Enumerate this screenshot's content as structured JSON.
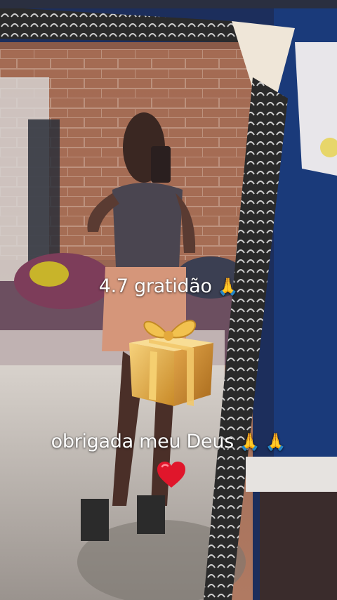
{
  "overlay": {
    "line1_text": "4.7 gratidão",
    "line1_emoji": "🙏",
    "line2_text": "obrigada meu Deus",
    "line2_emojis": "🙏 🙏",
    "gift_icon": "gift-box-icon",
    "heart_icon": "red-heart-icon",
    "heart_color": "#e0162b",
    "gift_color": "#e7b24a"
  }
}
